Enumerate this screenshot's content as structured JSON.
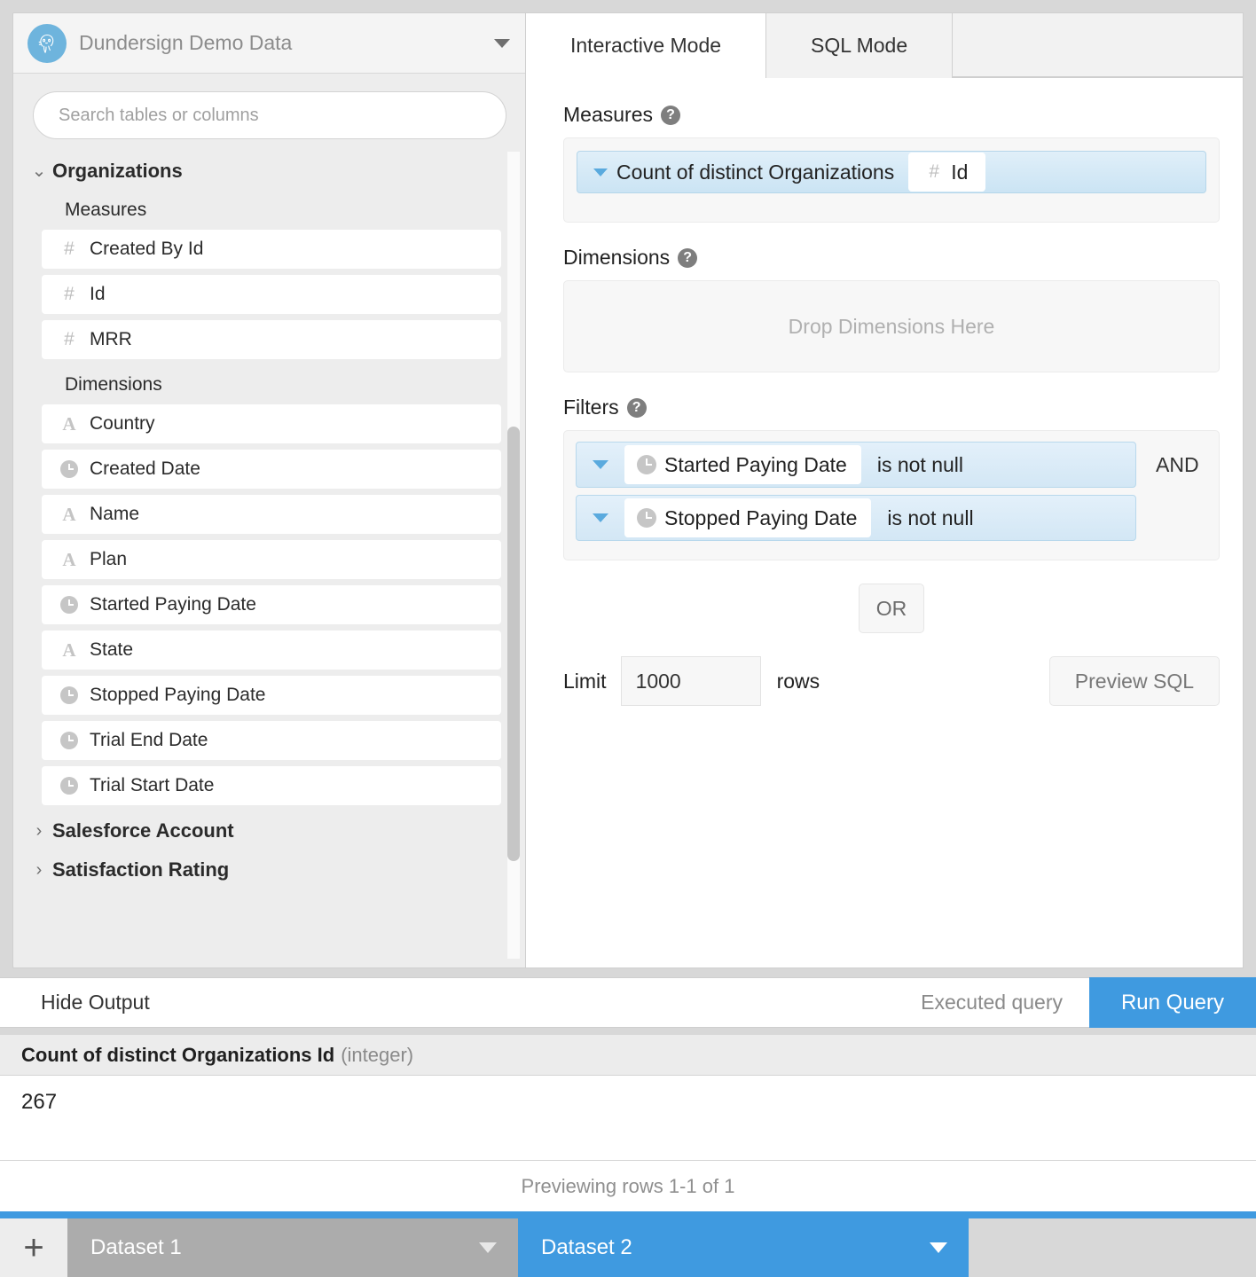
{
  "sidebar": {
    "database": {
      "name": "Dundersign Demo Data",
      "logo_icon": "postgres-elephant-icon",
      "dropdown_icon": "caret-down-icon"
    },
    "search": {
      "placeholder": "Search tables or columns",
      "value": ""
    },
    "tree": [
      {
        "name": "Organizations",
        "expanded": true,
        "groups": [
          {
            "label": "Measures",
            "fields": [
              {
                "name": "Created By Id",
                "icon": "hash-icon"
              },
              {
                "name": "Id",
                "icon": "hash-icon"
              },
              {
                "name": "MRR",
                "icon": "hash-icon"
              }
            ]
          },
          {
            "label": "Dimensions",
            "fields": [
              {
                "name": "Country",
                "icon": "text-icon"
              },
              {
                "name": "Created Date",
                "icon": "clock-icon"
              },
              {
                "name": "Name",
                "icon": "text-icon"
              },
              {
                "name": "Plan",
                "icon": "text-icon"
              },
              {
                "name": "Started Paying Date",
                "icon": "clock-icon"
              },
              {
                "name": "State",
                "icon": "text-icon"
              },
              {
                "name": "Stopped Paying Date",
                "icon": "clock-icon"
              },
              {
                "name": "Trial End Date",
                "icon": "clock-icon"
              },
              {
                "name": "Trial Start Date",
                "icon": "clock-icon"
              }
            ]
          }
        ]
      },
      {
        "name": "Salesforce Account",
        "expanded": false,
        "groups": []
      },
      {
        "name": "Satisfaction Rating",
        "expanded": false,
        "groups": []
      }
    ]
  },
  "query_panel": {
    "tabs": [
      {
        "label": "Interactive Mode",
        "active": true
      },
      {
        "label": "SQL Mode",
        "active": false
      }
    ],
    "measures": {
      "label": "Measures",
      "help_icon": "help-icon",
      "items": [
        {
          "aggregation": "Count of distinct Organizations",
          "field": "Id",
          "field_icon": "hash-icon",
          "caret_icon": "caret-down-icon"
        }
      ]
    },
    "dimensions": {
      "label": "Dimensions",
      "help_icon": "help-icon",
      "placeholder": "Drop Dimensions Here",
      "items": []
    },
    "filters": {
      "label": "Filters",
      "help_icon": "help-icon",
      "rows": [
        {
          "field": "Started Paying Date",
          "field_icon": "clock-icon",
          "operator": "is not null",
          "conjunction": "AND",
          "caret_icon": "caret-down-icon"
        },
        {
          "field": "Stopped Paying Date",
          "field_icon": "clock-icon",
          "operator": "is not null",
          "conjunction": "",
          "caret_icon": "caret-down-icon"
        }
      ]
    },
    "or_button": "OR",
    "limit": {
      "label": "Limit",
      "value": "1000",
      "unit": "rows"
    },
    "preview_sql_button": "Preview SQL"
  },
  "output": {
    "hide_output": "Hide Output",
    "status": "Executed query",
    "run_button": "Run Query",
    "table": {
      "column_name": "Count of distinct Organizations Id",
      "column_type": "(integer)",
      "rows": [
        "267"
      ]
    },
    "preview_status": "Previewing rows 1-1 of 1"
  },
  "dataset_bar": {
    "add_label": "+",
    "add_icon": "plus-icon",
    "tabs": [
      {
        "label": "Dataset 1",
        "active": false,
        "caret_icon": "caret-down-icon"
      },
      {
        "label": "Dataset 2",
        "active": true,
        "caret_icon": "caret-down-icon"
      }
    ]
  },
  "colors": {
    "accent_blue": "#3f9ae0",
    "pill_blue": "#d3e7f5",
    "inactive_tab_gray": "#acacac",
    "logo_blue": "#6eb4dd"
  }
}
